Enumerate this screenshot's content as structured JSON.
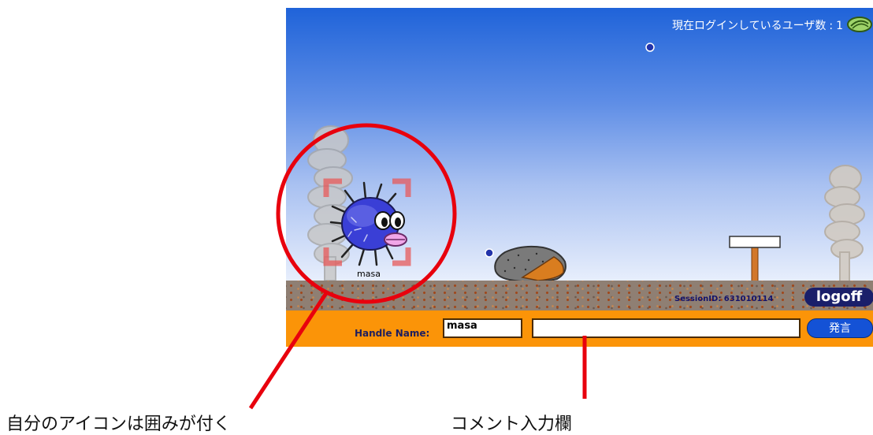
{
  "header": {
    "users_label": "現在ログインしているユーザ数",
    "users_separator": ":",
    "users_count": "1"
  },
  "avatar": {
    "name": "masa",
    "selected": true
  },
  "session": {
    "label": "SessionID: 631010114"
  },
  "logoff": {
    "label": "logoff"
  },
  "chat_bar": {
    "handle_label": "Handle Name:",
    "handle_value": "masa",
    "comment_value": "",
    "speak_label": "発言"
  },
  "annotations": {
    "own_icon": "自分のアイコンは囲みが付く",
    "comment_field": "コメント入力欄"
  },
  "colors": {
    "sky_top": "#1f63d9",
    "bar": "#fb9408",
    "annotation": "#e8000d",
    "button": "#1452d6"
  },
  "icons": [
    "shell-icon",
    "bubble-icon",
    "pufferfish-avatar",
    "rock",
    "signpost",
    "seaweed"
  ]
}
